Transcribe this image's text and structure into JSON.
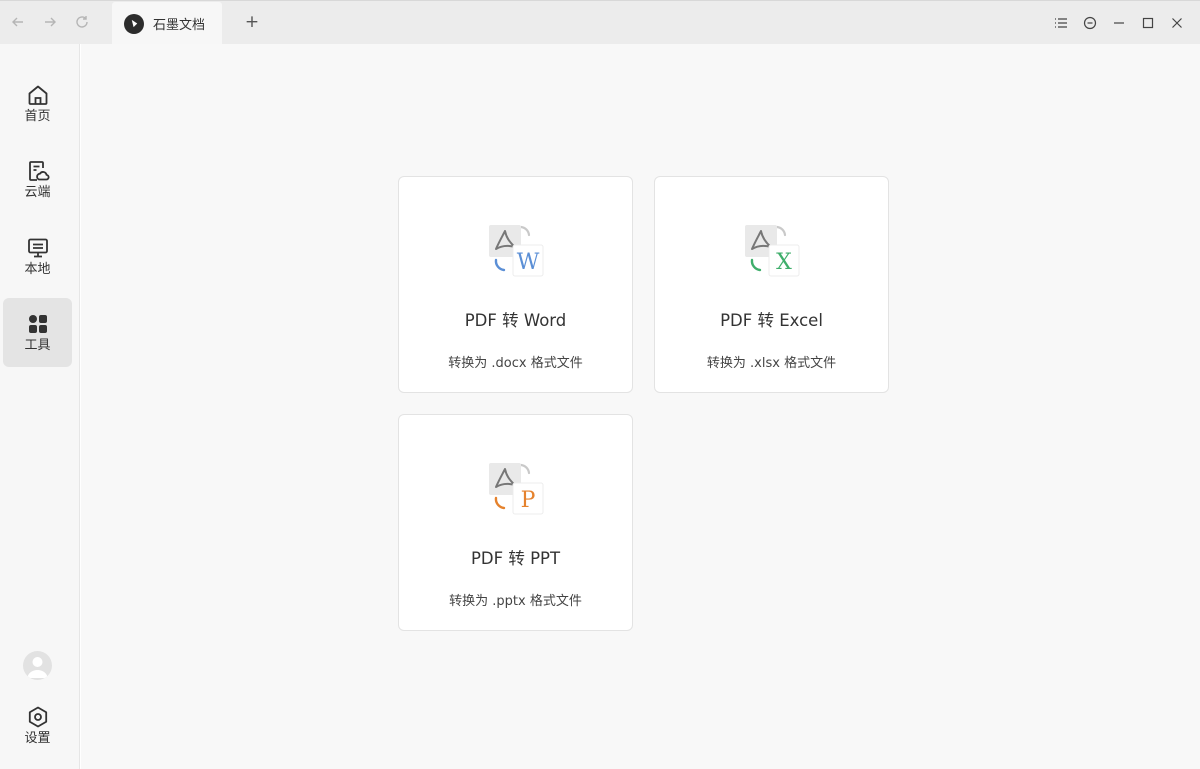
{
  "app": {
    "tab_title": "石墨文档",
    "new_tab_symbol": "+"
  },
  "titlebar": {
    "nav_icons": [
      "back-arrow-icon",
      "forward-arrow-icon",
      "refresh-icon"
    ],
    "window_icons": [
      "list-icon",
      "minus-circle-icon",
      "minimize-icon",
      "maximize-icon",
      "close-icon"
    ]
  },
  "sidebar": {
    "items": [
      {
        "label": "首页",
        "icon": "home-icon"
      },
      {
        "label": "云端",
        "icon": "cloud-doc-icon"
      },
      {
        "label": "本地",
        "icon": "monitor-icon"
      },
      {
        "label": "工具",
        "icon": "tools-grid-icon",
        "active": true
      }
    ],
    "settings_label": "设置"
  },
  "tools": [
    {
      "title": "PDF 转 Word",
      "subtitle": "转换为 .docx 格式文件",
      "letter": "W",
      "color": "#5b8fd6"
    },
    {
      "title": "PDF 转 Excel",
      "subtitle": "转换为 .xlsx 格式文件",
      "letter": "X",
      "color": "#3fae6b"
    },
    {
      "title": "PDF 转 PPT",
      "subtitle": "转换为 .pptx 格式文件",
      "letter": "P",
      "color": "#e5822d"
    }
  ]
}
